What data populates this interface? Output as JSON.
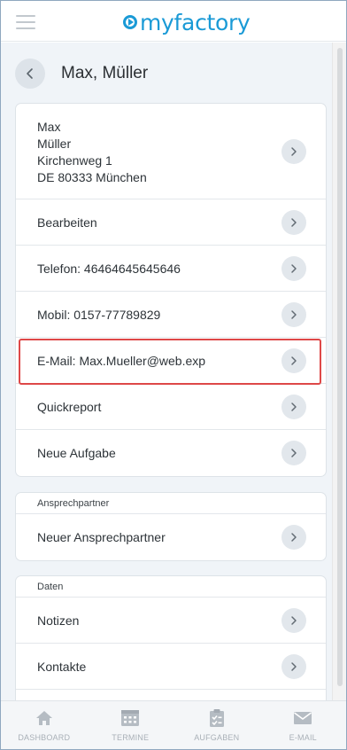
{
  "app": {
    "logo_text": "myfactory",
    "brand_color": "#1a9ad6",
    "menu_icon": "hamburger-icon"
  },
  "header": {
    "back_icon": "chevron-left-icon",
    "title": "Max, Müller"
  },
  "contact_card": {
    "address_lines": [
      "Max",
      "Müller",
      "Kirchenweg 1",
      "DE 80333 München"
    ],
    "items": [
      {
        "label": "Bearbeiten"
      },
      {
        "label": "Telefon: 46464645645646"
      },
      {
        "label": "Mobil: 0157-77789829"
      },
      {
        "label": "E-Mail: Max.Mueller@web.exp",
        "highlighted": true
      },
      {
        "label": "Quickreport"
      },
      {
        "label": "Neue Aufgabe"
      }
    ]
  },
  "ansprechpartner_card": {
    "caption": "Ansprechpartner",
    "items": [
      {
        "label": "Neuer Ansprechpartner"
      }
    ]
  },
  "daten_card": {
    "caption": "Daten",
    "items": [
      {
        "label": "Notizen"
      },
      {
        "label": "Kontakte"
      },
      {
        "label": ""
      }
    ]
  },
  "bottom_nav": [
    {
      "label": "DASHBOARD",
      "icon": "home-icon"
    },
    {
      "label": "TERMINE",
      "icon": "calendar-icon"
    },
    {
      "label": "AUFGABEN",
      "icon": "clipboard-icon"
    },
    {
      "label": "E-MAIL",
      "icon": "envelope-icon"
    }
  ],
  "colors": {
    "highlight_border": "#de4848",
    "content_bg": "#f0f4f8",
    "chevron_bg": "#e2e7ec"
  }
}
